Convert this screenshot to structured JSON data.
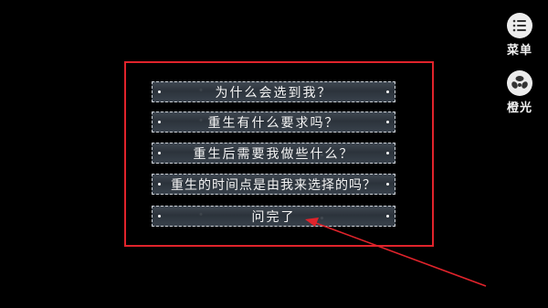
{
  "side_menu": {
    "menu_label": "菜单",
    "menu_icon": "list-icon",
    "lighting_label": "橙光",
    "lighting_icon": "orange-light-logo-icon"
  },
  "dialog": {
    "options": [
      {
        "label": "为什么会选到我？"
      },
      {
        "label": "重生有什么要求吗？"
      },
      {
        "label": "重生后需要我做些什么？"
      },
      {
        "label": "重生的时间点是由我来选择的吗？"
      },
      {
        "label": "问完了"
      }
    ]
  },
  "colors": {
    "highlight": "#e0232b",
    "background": "#000000",
    "option_bg": "#323a43"
  }
}
